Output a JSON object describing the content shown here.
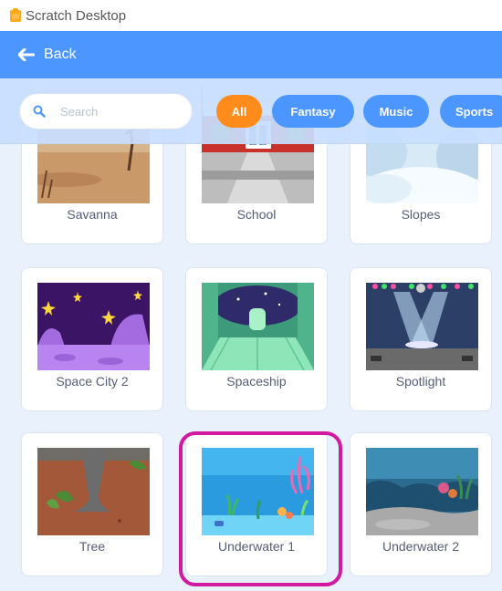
{
  "window": {
    "title": "Scratch Desktop"
  },
  "menu": {
    "back_label": "Back"
  },
  "filter": {
    "search_placeholder": "Search",
    "tags": [
      "All",
      "Fantasy",
      "Music",
      "Sports"
    ],
    "active_tag": "All"
  },
  "backdrops": [
    {
      "label": "Savanna"
    },
    {
      "label": "School"
    },
    {
      "label": "Slopes"
    },
    {
      "label": "Space City 2"
    },
    {
      "label": "Spaceship"
    },
    {
      "label": "Spotlight"
    },
    {
      "label": "Tree"
    },
    {
      "label": "Underwater 1"
    },
    {
      "label": "Underwater 2"
    }
  ],
  "highlighted_item": "Underwater 1",
  "colors": {
    "accent": "#4c97ff",
    "active_tag": "#ff8c1a",
    "highlight": "#d21aa0"
  }
}
